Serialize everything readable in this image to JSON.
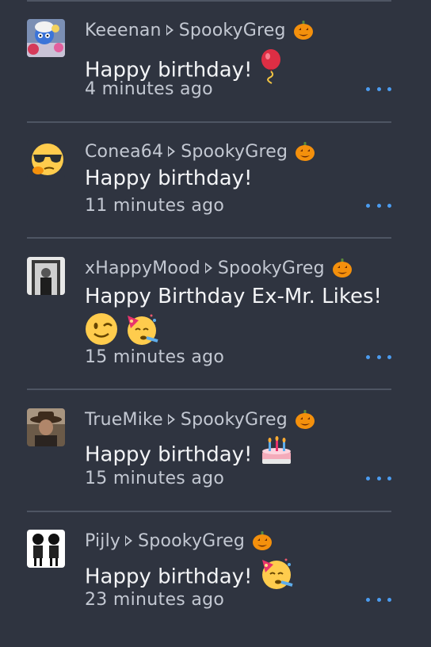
{
  "posts": [
    {
      "author": "Keeenan",
      "recipient": "SpookyGreg",
      "recipient_badge_icon": "pumpkin-icon",
      "message": "Happy birthday!",
      "message_emoji": [
        "balloon-icon"
      ],
      "time": "4 minutes ago",
      "avatar_icon": "smurf-avatar"
    },
    {
      "author": "Conea64",
      "recipient": "SpookyGreg",
      "recipient_badge_icon": "pumpkin-icon",
      "message": "Happy birthday!",
      "message_emoji": [],
      "time": "11 minutes ago",
      "avatar_icon": "sunglasses-face-avatar"
    },
    {
      "author": "xHappyMood",
      "recipient": "SpookyGreg",
      "recipient_badge_icon": "pumpkin-icon",
      "message": "Happy Birthday Ex-Mr. Likes!",
      "message_emoji": [
        "winking-face-icon",
        "partying-face-icon"
      ],
      "time": "15 minutes ago",
      "avatar_icon": "person-photo-avatar"
    },
    {
      "author": "TrueMike",
      "recipient": "SpookyGreg",
      "recipient_badge_icon": "pumpkin-icon",
      "message": "Happy birthday!",
      "message_emoji": [
        "birthday-cake-icon"
      ],
      "time": "15 minutes ago",
      "avatar_icon": "cowboy-photo-avatar"
    },
    {
      "author": "Pijly",
      "recipient": "SpookyGreg",
      "recipient_badge_icon": "pumpkin-icon",
      "message": "Happy birthday!",
      "message_emoji": [
        "partying-face-icon"
      ],
      "time": "23 minutes ago",
      "avatar_icon": "cartoon-couple-avatar"
    }
  ],
  "colors": {
    "background": "#2f3440",
    "divider": "#4e5563",
    "accent": "#4b9cf0",
    "meta_text": "#c3c8d2",
    "body_text": "#f3f4f6"
  }
}
